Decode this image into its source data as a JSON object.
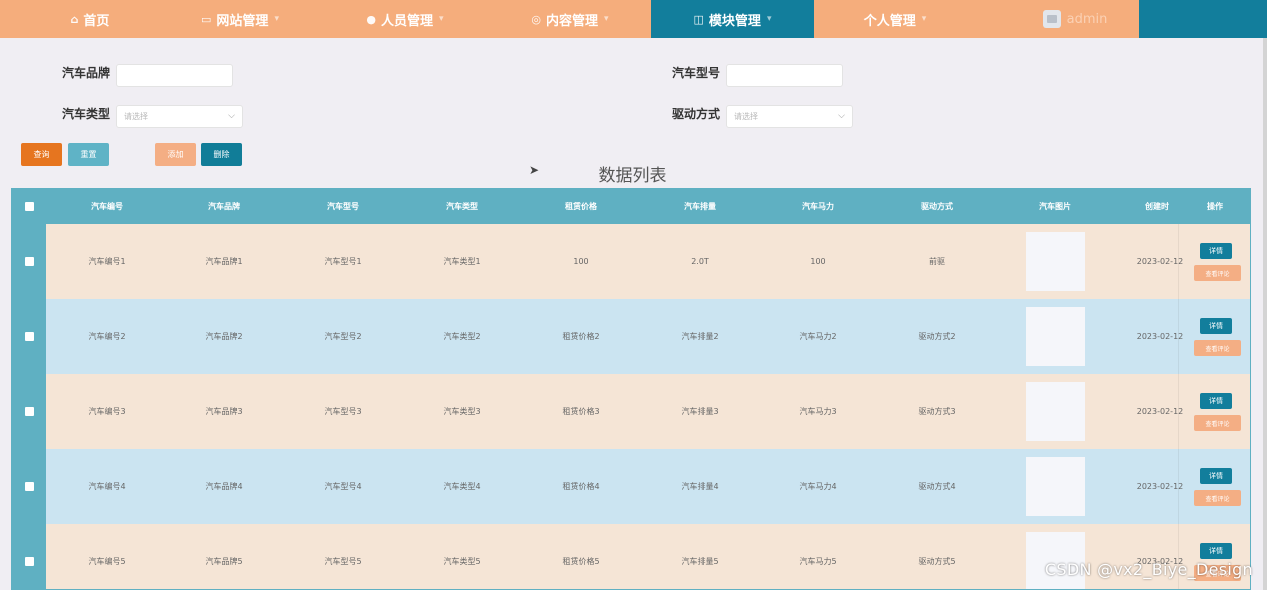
{
  "nav": {
    "items": [
      {
        "label": "首页",
        "icon": "home-icon",
        "glyph": "⌂",
        "caret": ""
      },
      {
        "label": "网站管理",
        "icon": "monitor-icon",
        "glyph": "▭",
        "caret": "▾"
      },
      {
        "label": "人员管理",
        "icon": "user-icon",
        "glyph": "●",
        "caret": "▾"
      },
      {
        "label": "内容管理",
        "icon": "content-icon",
        "glyph": "◎",
        "caret": "▾"
      },
      {
        "label": "模块管理",
        "icon": "module-icon",
        "glyph": "◫",
        "caret": "▾"
      },
      {
        "label": "个人管理",
        "icon": "",
        "glyph": "",
        "caret": "▾"
      }
    ],
    "user": "admin",
    "active_index": 4
  },
  "search": {
    "brand_label": "汽车品牌",
    "model_label": "汽车型号",
    "type_label": "汽车类型",
    "type_placeholder": "请选择",
    "drive_label": "驱动方式",
    "drive_placeholder": "请选择"
  },
  "buttons": {
    "search": "查询",
    "reset": "重置",
    "add": "添加",
    "delete": "删除"
  },
  "list_title": "数据列表",
  "table": {
    "headers": [
      "汽车编号",
      "汽车品牌",
      "汽车型号",
      "汽车类型",
      "租赁价格",
      "汽车排量",
      "汽车马力",
      "驱动方式",
      "汽车图片",
      "创建时",
      "操作"
    ],
    "rows": [
      [
        "汽车编号1",
        "汽车品牌1",
        "汽车型号1",
        "汽车类型1",
        "100",
        "2.0T",
        "100",
        "前驱",
        "2023-02-12"
      ],
      [
        "汽车编号2",
        "汽车品牌2",
        "汽车型号2",
        "汽车类型2",
        "租赁价格2",
        "汽车排量2",
        "汽车马力2",
        "驱动方式2",
        "2023-02-12"
      ],
      [
        "汽车编号3",
        "汽车品牌3",
        "汽车型号3",
        "汽车类型3",
        "租赁价格3",
        "汽车排量3",
        "汽车马力3",
        "驱动方式3",
        "2023-02-12"
      ],
      [
        "汽车编号4",
        "汽车品牌4",
        "汽车型号4",
        "汽车类型4",
        "租赁价格4",
        "汽车排量4",
        "汽车马力4",
        "驱动方式4",
        "2023-02-12"
      ],
      [
        "汽车编号5",
        "汽车品牌5",
        "汽车型号5",
        "汽车类型5",
        "租赁价格5",
        "汽车排量5",
        "汽车马力5",
        "驱动方式5",
        "2023-02-12"
      ]
    ],
    "detail_label": "详情",
    "comment_label": "查看评论"
  },
  "watermark": "CSDN @vx2_Biye_Design",
  "colors": {
    "nav_bg": "#f5ad7c",
    "nav_active": "#127e9c",
    "header_bg": "#5fb0c2",
    "row_odd": "#f5e5d6",
    "row_even": "#cbe4f1"
  }
}
